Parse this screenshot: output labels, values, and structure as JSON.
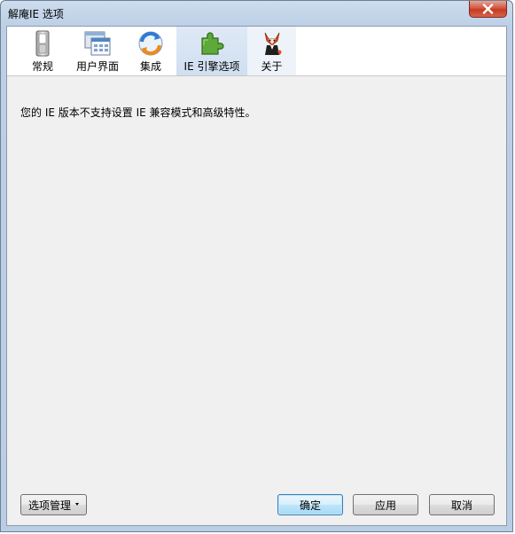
{
  "window": {
    "title": "解庵IE 选项"
  },
  "tabs": [
    {
      "label": "常规",
      "icon": "switch-icon"
    },
    {
      "label": "用户界面",
      "icon": "window-icon"
    },
    {
      "label": "集成",
      "icon": "sync-icon"
    },
    {
      "label": "IE 引擎选项",
      "icon": "puzzle-icon",
      "selected": true
    },
    {
      "label": "关于",
      "icon": "fox-icon"
    }
  ],
  "content": {
    "message": "您的 IE 版本不支持设置 IE 兼容模式和高级特性。"
  },
  "buttons": {
    "options_manage": "选项管理",
    "ok": "确定",
    "apply": "应用",
    "cancel": "取消"
  },
  "colors": {
    "selected_tab": "#cfdff1",
    "close_button": "#c43b22",
    "client_background": "#f0f0f0"
  }
}
